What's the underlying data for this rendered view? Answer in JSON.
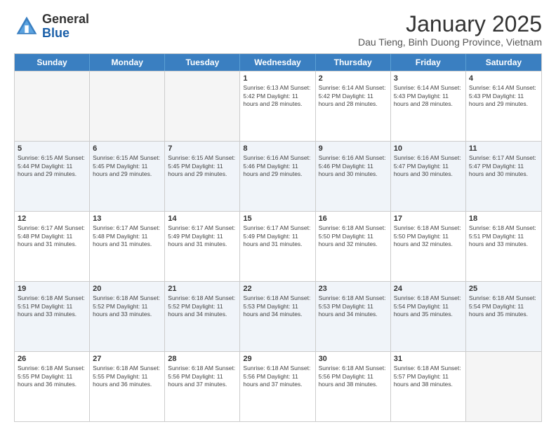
{
  "header": {
    "logo_line1": "General",
    "logo_line2": "Blue",
    "month_title": "January 2025",
    "location": "Dau Tieng, Binh Duong Province, Vietnam"
  },
  "days_of_week": [
    "Sunday",
    "Monday",
    "Tuesday",
    "Wednesday",
    "Thursday",
    "Friday",
    "Saturday"
  ],
  "weeks": [
    [
      {
        "day": "",
        "info": ""
      },
      {
        "day": "",
        "info": ""
      },
      {
        "day": "",
        "info": ""
      },
      {
        "day": "1",
        "info": "Sunrise: 6:13 AM\nSunset: 5:42 PM\nDaylight: 11 hours\nand 28 minutes."
      },
      {
        "day": "2",
        "info": "Sunrise: 6:14 AM\nSunset: 5:42 PM\nDaylight: 11 hours\nand 28 minutes."
      },
      {
        "day": "3",
        "info": "Sunrise: 6:14 AM\nSunset: 5:43 PM\nDaylight: 11 hours\nand 28 minutes."
      },
      {
        "day": "4",
        "info": "Sunrise: 6:14 AM\nSunset: 5:43 PM\nDaylight: 11 hours\nand 29 minutes."
      }
    ],
    [
      {
        "day": "5",
        "info": "Sunrise: 6:15 AM\nSunset: 5:44 PM\nDaylight: 11 hours\nand 29 minutes."
      },
      {
        "day": "6",
        "info": "Sunrise: 6:15 AM\nSunset: 5:45 PM\nDaylight: 11 hours\nand 29 minutes."
      },
      {
        "day": "7",
        "info": "Sunrise: 6:15 AM\nSunset: 5:45 PM\nDaylight: 11 hours\nand 29 minutes."
      },
      {
        "day": "8",
        "info": "Sunrise: 6:16 AM\nSunset: 5:46 PM\nDaylight: 11 hours\nand 29 minutes."
      },
      {
        "day": "9",
        "info": "Sunrise: 6:16 AM\nSunset: 5:46 PM\nDaylight: 11 hours\nand 30 minutes."
      },
      {
        "day": "10",
        "info": "Sunrise: 6:16 AM\nSunset: 5:47 PM\nDaylight: 11 hours\nand 30 minutes."
      },
      {
        "day": "11",
        "info": "Sunrise: 6:17 AM\nSunset: 5:47 PM\nDaylight: 11 hours\nand 30 minutes."
      }
    ],
    [
      {
        "day": "12",
        "info": "Sunrise: 6:17 AM\nSunset: 5:48 PM\nDaylight: 11 hours\nand 31 minutes."
      },
      {
        "day": "13",
        "info": "Sunrise: 6:17 AM\nSunset: 5:48 PM\nDaylight: 11 hours\nand 31 minutes."
      },
      {
        "day": "14",
        "info": "Sunrise: 6:17 AM\nSunset: 5:49 PM\nDaylight: 11 hours\nand 31 minutes."
      },
      {
        "day": "15",
        "info": "Sunrise: 6:17 AM\nSunset: 5:49 PM\nDaylight: 11 hours\nand 31 minutes."
      },
      {
        "day": "16",
        "info": "Sunrise: 6:18 AM\nSunset: 5:50 PM\nDaylight: 11 hours\nand 32 minutes."
      },
      {
        "day": "17",
        "info": "Sunrise: 6:18 AM\nSunset: 5:50 PM\nDaylight: 11 hours\nand 32 minutes."
      },
      {
        "day": "18",
        "info": "Sunrise: 6:18 AM\nSunset: 5:51 PM\nDaylight: 11 hours\nand 33 minutes."
      }
    ],
    [
      {
        "day": "19",
        "info": "Sunrise: 6:18 AM\nSunset: 5:51 PM\nDaylight: 11 hours\nand 33 minutes."
      },
      {
        "day": "20",
        "info": "Sunrise: 6:18 AM\nSunset: 5:52 PM\nDaylight: 11 hours\nand 33 minutes."
      },
      {
        "day": "21",
        "info": "Sunrise: 6:18 AM\nSunset: 5:52 PM\nDaylight: 11 hours\nand 34 minutes."
      },
      {
        "day": "22",
        "info": "Sunrise: 6:18 AM\nSunset: 5:53 PM\nDaylight: 11 hours\nand 34 minutes."
      },
      {
        "day": "23",
        "info": "Sunrise: 6:18 AM\nSunset: 5:53 PM\nDaylight: 11 hours\nand 34 minutes."
      },
      {
        "day": "24",
        "info": "Sunrise: 6:18 AM\nSunset: 5:54 PM\nDaylight: 11 hours\nand 35 minutes."
      },
      {
        "day": "25",
        "info": "Sunrise: 6:18 AM\nSunset: 5:54 PM\nDaylight: 11 hours\nand 35 minutes."
      }
    ],
    [
      {
        "day": "26",
        "info": "Sunrise: 6:18 AM\nSunset: 5:55 PM\nDaylight: 11 hours\nand 36 minutes."
      },
      {
        "day": "27",
        "info": "Sunrise: 6:18 AM\nSunset: 5:55 PM\nDaylight: 11 hours\nand 36 minutes."
      },
      {
        "day": "28",
        "info": "Sunrise: 6:18 AM\nSunset: 5:56 PM\nDaylight: 11 hours\nand 37 minutes."
      },
      {
        "day": "29",
        "info": "Sunrise: 6:18 AM\nSunset: 5:56 PM\nDaylight: 11 hours\nand 37 minutes."
      },
      {
        "day": "30",
        "info": "Sunrise: 6:18 AM\nSunset: 5:56 PM\nDaylight: 11 hours\nand 38 minutes."
      },
      {
        "day": "31",
        "info": "Sunrise: 6:18 AM\nSunset: 5:57 PM\nDaylight: 11 hours\nand 38 minutes."
      },
      {
        "day": "",
        "info": ""
      }
    ]
  ]
}
